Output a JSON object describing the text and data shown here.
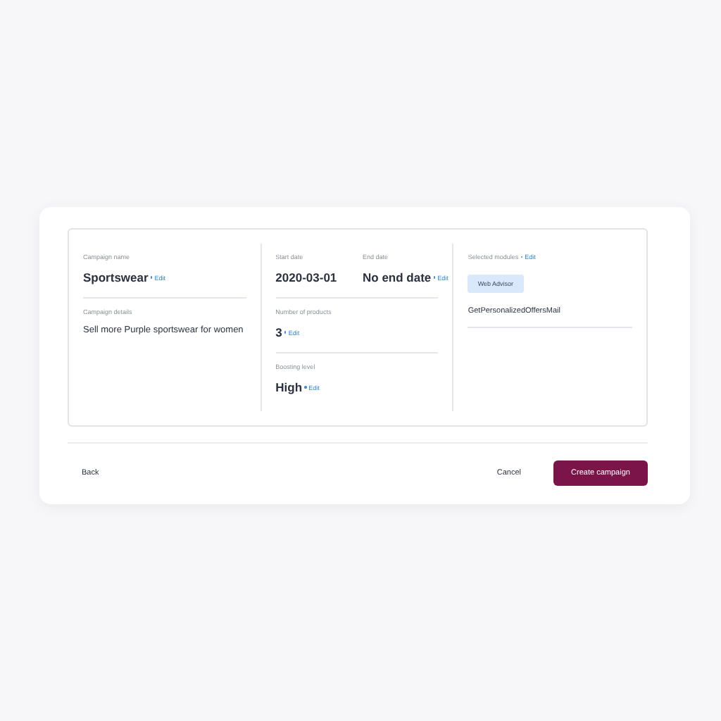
{
  "summary": {
    "columns": [
      {
        "rows": [
          [
            {
              "label": "Campaign name",
              "value": "Sportswear",
              "edit": "Edit",
              "kind": "heading"
            }
          ],
          [
            {
              "label": "Campaign details",
              "value": "Sell more Purple sportswear for women",
              "kind": "text"
            }
          ]
        ]
      },
      {
        "rows": [
          [
            {
              "label": "Start date",
              "value": "2020-03-01",
              "kind": "heading"
            },
            {
              "label": "End date",
              "value": "No end date",
              "edit": "Edit",
              "kind": "heading"
            }
          ],
          [
            {
              "label": "Number of products",
              "value": "3",
              "edit": "Edit",
              "kind": "heading"
            }
          ],
          [
            {
              "label": "Boosting level",
              "value": "High",
              "edit": "Edit",
              "kind": "heading"
            }
          ]
        ]
      }
    ],
    "modules": {
      "label": "Selected modules",
      "edit": "Edit",
      "tags": [
        "Web Advisor"
      ],
      "items": [
        "GetPersonalizedOffersMail"
      ]
    }
  },
  "footer": {
    "back": "Back",
    "cancel": "Cancel",
    "create": "Create campaign"
  }
}
